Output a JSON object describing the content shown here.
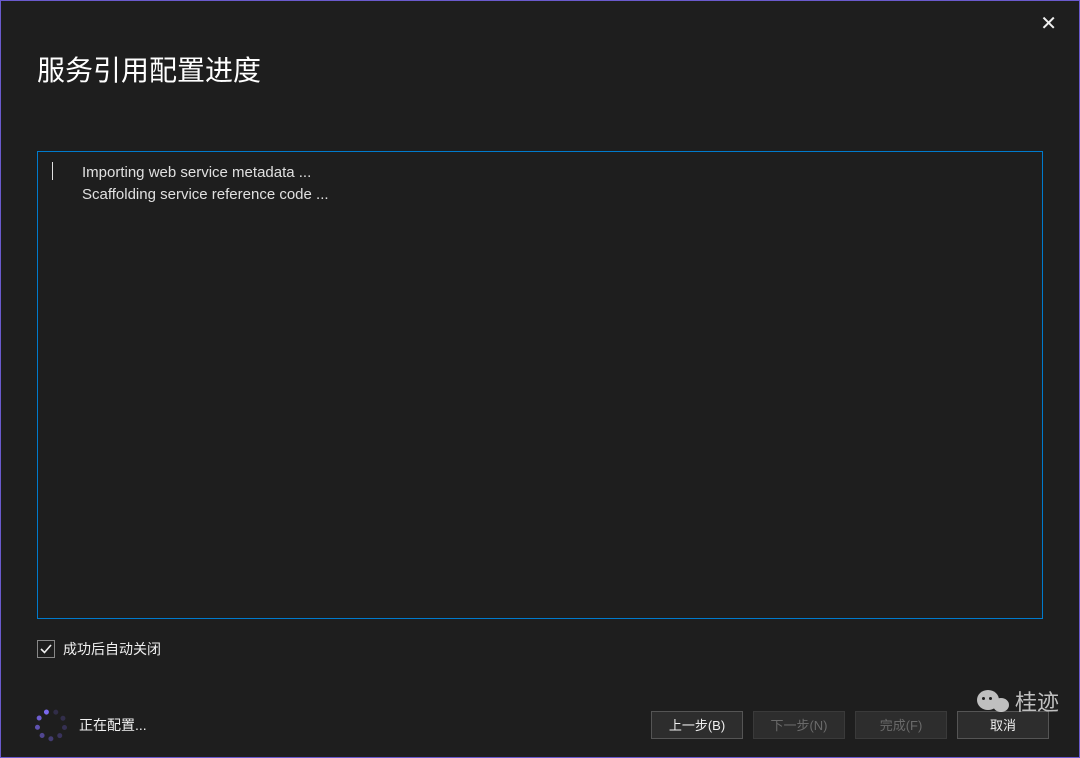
{
  "dialog": {
    "title": "服务引用配置进度",
    "close_tooltip": "关闭"
  },
  "log": {
    "lines": [
      "Importing web service metadata ...",
      "Scaffolding service reference code ..."
    ]
  },
  "checkbox": {
    "auto_close_label": "成功后自动关闭",
    "checked": true
  },
  "status": {
    "text": "正在配置..."
  },
  "buttons": {
    "back": "上一步(B)",
    "next": "下一步(N)",
    "finish": "完成(F)",
    "cancel": "取消"
  },
  "watermark": {
    "text": "桂迹"
  }
}
